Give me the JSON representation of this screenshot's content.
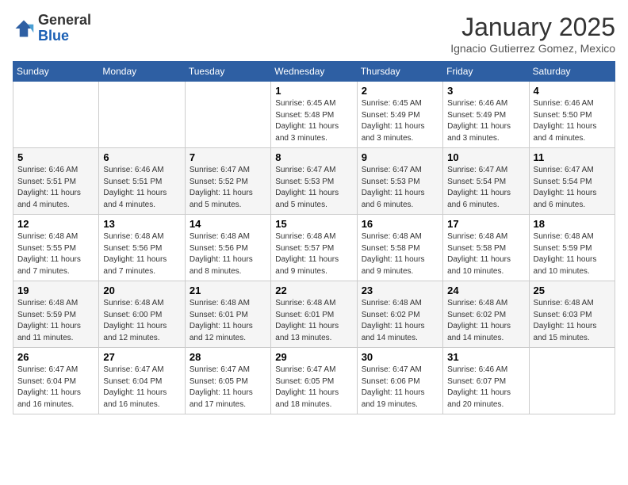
{
  "header": {
    "logo_line1": "General",
    "logo_line2": "Blue",
    "month": "January 2025",
    "location": "Ignacio Gutierrez Gomez, Mexico"
  },
  "weekdays": [
    "Sunday",
    "Monday",
    "Tuesday",
    "Wednesday",
    "Thursday",
    "Friday",
    "Saturday"
  ],
  "weeks": [
    [
      {
        "day": "",
        "info": ""
      },
      {
        "day": "",
        "info": ""
      },
      {
        "day": "",
        "info": ""
      },
      {
        "day": "1",
        "info": "Sunrise: 6:45 AM\nSunset: 5:48 PM\nDaylight: 11 hours\nand 3 minutes."
      },
      {
        "day": "2",
        "info": "Sunrise: 6:45 AM\nSunset: 5:49 PM\nDaylight: 11 hours\nand 3 minutes."
      },
      {
        "day": "3",
        "info": "Sunrise: 6:46 AM\nSunset: 5:49 PM\nDaylight: 11 hours\nand 3 minutes."
      },
      {
        "day": "4",
        "info": "Sunrise: 6:46 AM\nSunset: 5:50 PM\nDaylight: 11 hours\nand 4 minutes."
      }
    ],
    [
      {
        "day": "5",
        "info": "Sunrise: 6:46 AM\nSunset: 5:51 PM\nDaylight: 11 hours\nand 4 minutes."
      },
      {
        "day": "6",
        "info": "Sunrise: 6:46 AM\nSunset: 5:51 PM\nDaylight: 11 hours\nand 4 minutes."
      },
      {
        "day": "7",
        "info": "Sunrise: 6:47 AM\nSunset: 5:52 PM\nDaylight: 11 hours\nand 5 minutes."
      },
      {
        "day": "8",
        "info": "Sunrise: 6:47 AM\nSunset: 5:53 PM\nDaylight: 11 hours\nand 5 minutes."
      },
      {
        "day": "9",
        "info": "Sunrise: 6:47 AM\nSunset: 5:53 PM\nDaylight: 11 hours\nand 6 minutes."
      },
      {
        "day": "10",
        "info": "Sunrise: 6:47 AM\nSunset: 5:54 PM\nDaylight: 11 hours\nand 6 minutes."
      },
      {
        "day": "11",
        "info": "Sunrise: 6:47 AM\nSunset: 5:54 PM\nDaylight: 11 hours\nand 6 minutes."
      }
    ],
    [
      {
        "day": "12",
        "info": "Sunrise: 6:48 AM\nSunset: 5:55 PM\nDaylight: 11 hours\nand 7 minutes."
      },
      {
        "day": "13",
        "info": "Sunrise: 6:48 AM\nSunset: 5:56 PM\nDaylight: 11 hours\nand 7 minutes."
      },
      {
        "day": "14",
        "info": "Sunrise: 6:48 AM\nSunset: 5:56 PM\nDaylight: 11 hours\nand 8 minutes."
      },
      {
        "day": "15",
        "info": "Sunrise: 6:48 AM\nSunset: 5:57 PM\nDaylight: 11 hours\nand 9 minutes."
      },
      {
        "day": "16",
        "info": "Sunrise: 6:48 AM\nSunset: 5:58 PM\nDaylight: 11 hours\nand 9 minutes."
      },
      {
        "day": "17",
        "info": "Sunrise: 6:48 AM\nSunset: 5:58 PM\nDaylight: 11 hours\nand 10 minutes."
      },
      {
        "day": "18",
        "info": "Sunrise: 6:48 AM\nSunset: 5:59 PM\nDaylight: 11 hours\nand 10 minutes."
      }
    ],
    [
      {
        "day": "19",
        "info": "Sunrise: 6:48 AM\nSunset: 5:59 PM\nDaylight: 11 hours\nand 11 minutes."
      },
      {
        "day": "20",
        "info": "Sunrise: 6:48 AM\nSunset: 6:00 PM\nDaylight: 11 hours\nand 12 minutes."
      },
      {
        "day": "21",
        "info": "Sunrise: 6:48 AM\nSunset: 6:01 PM\nDaylight: 11 hours\nand 12 minutes."
      },
      {
        "day": "22",
        "info": "Sunrise: 6:48 AM\nSunset: 6:01 PM\nDaylight: 11 hours\nand 13 minutes."
      },
      {
        "day": "23",
        "info": "Sunrise: 6:48 AM\nSunset: 6:02 PM\nDaylight: 11 hours\nand 14 minutes."
      },
      {
        "day": "24",
        "info": "Sunrise: 6:48 AM\nSunset: 6:02 PM\nDaylight: 11 hours\nand 14 minutes."
      },
      {
        "day": "25",
        "info": "Sunrise: 6:48 AM\nSunset: 6:03 PM\nDaylight: 11 hours\nand 15 minutes."
      }
    ],
    [
      {
        "day": "26",
        "info": "Sunrise: 6:47 AM\nSunset: 6:04 PM\nDaylight: 11 hours\nand 16 minutes."
      },
      {
        "day": "27",
        "info": "Sunrise: 6:47 AM\nSunset: 6:04 PM\nDaylight: 11 hours\nand 16 minutes."
      },
      {
        "day": "28",
        "info": "Sunrise: 6:47 AM\nSunset: 6:05 PM\nDaylight: 11 hours\nand 17 minutes."
      },
      {
        "day": "29",
        "info": "Sunrise: 6:47 AM\nSunset: 6:05 PM\nDaylight: 11 hours\nand 18 minutes."
      },
      {
        "day": "30",
        "info": "Sunrise: 6:47 AM\nSunset: 6:06 PM\nDaylight: 11 hours\nand 19 minutes."
      },
      {
        "day": "31",
        "info": "Sunrise: 6:46 AM\nSunset: 6:07 PM\nDaylight: 11 hours\nand 20 minutes."
      },
      {
        "day": "",
        "info": ""
      }
    ]
  ]
}
